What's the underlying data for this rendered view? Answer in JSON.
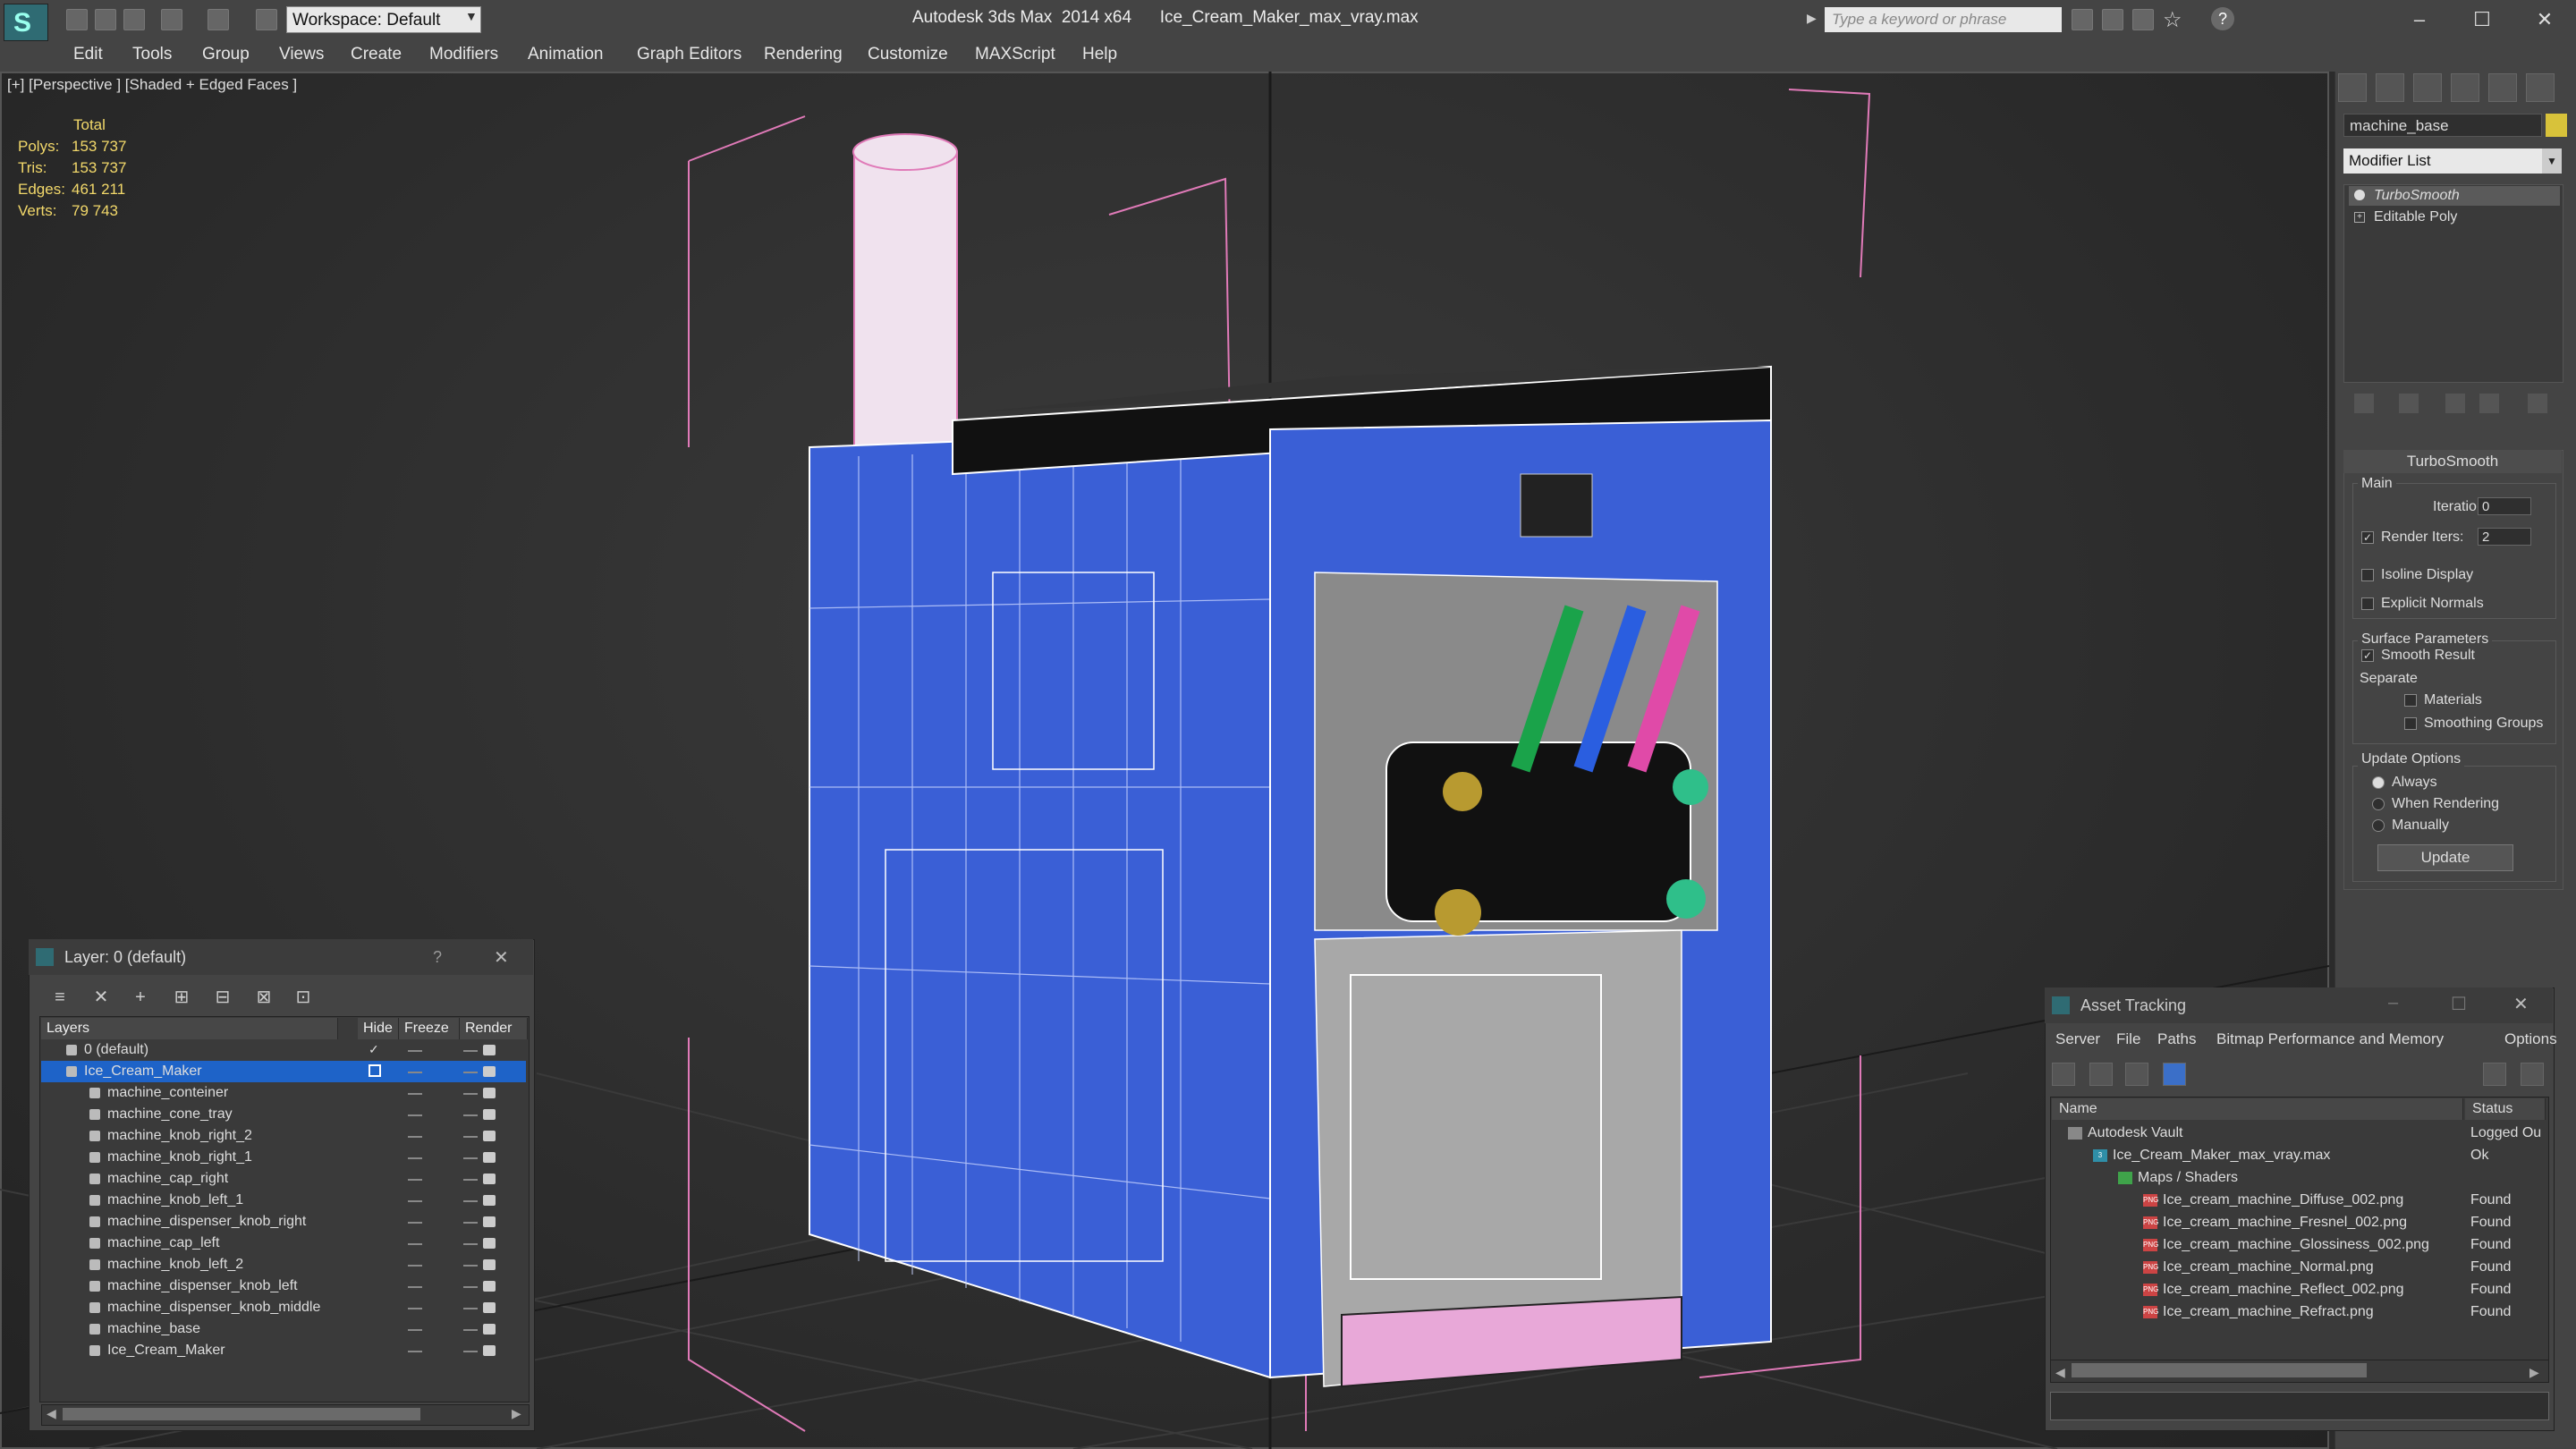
{
  "titlebar": {
    "workspace": "Workspace: Default",
    "app_title": "Autodesk 3ds Max  2014 x64      Ice_Cream_Maker_max_vray.max",
    "search_placeholder": "Type a keyword or phrase"
  },
  "menu": [
    "Edit",
    "Tools",
    "Group",
    "Views",
    "Create",
    "Modifiers",
    "Animation",
    "Graph Editors",
    "Rendering",
    "Customize",
    "MAXScript",
    "Help"
  ],
  "viewport": {
    "label": "[+] [Perspective ] [Shaded + Edged Faces ]",
    "stats": {
      "header": "Total",
      "rows": [
        {
          "k": "Polys:",
          "v": "153 737"
        },
        {
          "k": "Tris:",
          "v": "153 737"
        },
        {
          "k": "Edges:",
          "v": "461 211"
        },
        {
          "k": "Verts:",
          "v": "79 743"
        }
      ]
    }
  },
  "command_panel": {
    "object_name": "machine_base",
    "object_color": "#d8c23a",
    "modifier_list": "Modifier List",
    "stack": [
      "TurboSmooth",
      "Editable Poly"
    ],
    "turbosmooth": {
      "title": "TurboSmooth",
      "main": "Main",
      "iterations_label": "Iterations:",
      "iterations": "0",
      "render_iters_label": "Render Iters:",
      "render_iters": "2",
      "isoline": "Isoline Display",
      "explicit": "Explicit Normals",
      "surface": "Surface Parameters",
      "smooth_result": "Smooth Result",
      "separate": "Separate",
      "materials": "Materials",
      "smoothing_groups": "Smoothing Groups",
      "update_options": "Update Options",
      "always": "Always",
      "when_rendering": "When Rendering",
      "manually": "Manually",
      "update": "Update"
    }
  },
  "layer_dialog": {
    "title": "Layer: 0 (default)",
    "help": "?",
    "columns": [
      "Layers",
      "Hide",
      "Freeze",
      "Render"
    ],
    "rows": [
      {
        "name": "0 (default)",
        "level": 0,
        "selected": false
      },
      {
        "name": "Ice_Cream_Maker",
        "level": 0,
        "selected": true
      },
      {
        "name": "machine_conteiner",
        "level": 1
      },
      {
        "name": "machine_cone_tray",
        "level": 1
      },
      {
        "name": "machine_knob_right_2",
        "level": 1
      },
      {
        "name": "machine_knob_right_1",
        "level": 1
      },
      {
        "name": "machine_cap_right",
        "level": 1
      },
      {
        "name": "machine_knob_left_1",
        "level": 1
      },
      {
        "name": "machine_dispenser_knob_right",
        "level": 1
      },
      {
        "name": "machine_cap_left",
        "level": 1
      },
      {
        "name": "machine_knob_left_2",
        "level": 1
      },
      {
        "name": "machine_dispenser_knob_left",
        "level": 1
      },
      {
        "name": "machine_dispenser_knob_middle",
        "level": 1
      },
      {
        "name": "machine_base",
        "level": 1
      },
      {
        "name": "Ice_Cream_Maker",
        "level": 1
      }
    ]
  },
  "asset_tracking": {
    "title": "Asset Tracking",
    "menu": [
      "Server",
      "File",
      "Paths",
      "Bitmap Performance and Memory",
      "Options"
    ],
    "columns": [
      "Name",
      "Status"
    ],
    "rows": [
      {
        "name": "Autodesk Vault",
        "status": "Logged Ou",
        "indent": 0,
        "type": "vault"
      },
      {
        "name": "Ice_Cream_Maker_max_vray.max",
        "status": "Ok",
        "indent": 1,
        "type": "max"
      },
      {
        "name": "Maps / Shaders",
        "status": "",
        "indent": 2,
        "type": "folder"
      },
      {
        "name": "Ice_cream_machine_Diffuse_002.png",
        "status": "Found",
        "indent": 3,
        "type": "png"
      },
      {
        "name": "Ice_cream_machine_Fresnel_002.png",
        "status": "Found",
        "indent": 3,
        "type": "png"
      },
      {
        "name": "Ice_cream_machine_Glossiness_002.png",
        "status": "Found",
        "indent": 3,
        "type": "png"
      },
      {
        "name": "Ice_cream_machine_Normal.png",
        "status": "Found",
        "indent": 3,
        "type": "png"
      },
      {
        "name": "Ice_cream_machine_Reflect_002.png",
        "status": "Found",
        "indent": 3,
        "type": "png"
      },
      {
        "name": "Ice_cream_machine_Refract.png",
        "status": "Found",
        "indent": 3,
        "type": "png"
      }
    ]
  },
  "colors": {
    "machine_blue": "#3a5fd6",
    "selection_blue": "#1e63c8",
    "stats_yellow": "#f2d86a",
    "bbox_pink": "#e07ab8"
  }
}
